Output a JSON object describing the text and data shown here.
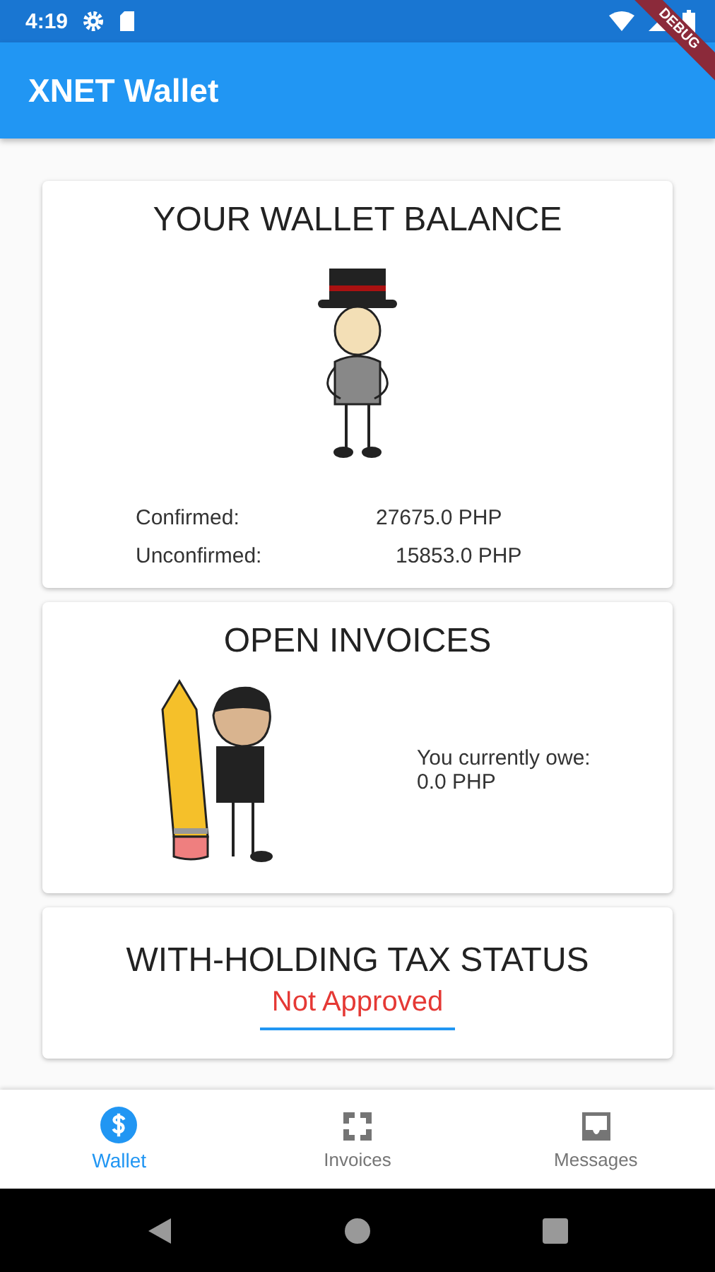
{
  "status_bar": {
    "time": "4:19"
  },
  "app_bar": {
    "title": "XNET Wallet"
  },
  "debug_banner": "DEBUG",
  "balance_card": {
    "title": "YOUR WALLET BALANCE",
    "rows": [
      {
        "label": "Confirmed:",
        "value": "27675.0 PHP"
      },
      {
        "label": "Unconfirmed:",
        "value": "15853.0 PHP"
      }
    ]
  },
  "invoices_card": {
    "title": "OPEN INVOICES",
    "owe_label": "You currently owe:",
    "owe_amount": "0.0 PHP"
  },
  "tax_card": {
    "title": "WITH-HOLDING TAX STATUS",
    "status": "Not Approved",
    "approved": false
  },
  "bottom_nav": [
    {
      "label": "Wallet",
      "kind": "wallet",
      "selected": true
    },
    {
      "label": "Invoices",
      "kind": "invoices",
      "selected": false
    },
    {
      "label": "Messages",
      "kind": "messages",
      "selected": false
    }
  ]
}
